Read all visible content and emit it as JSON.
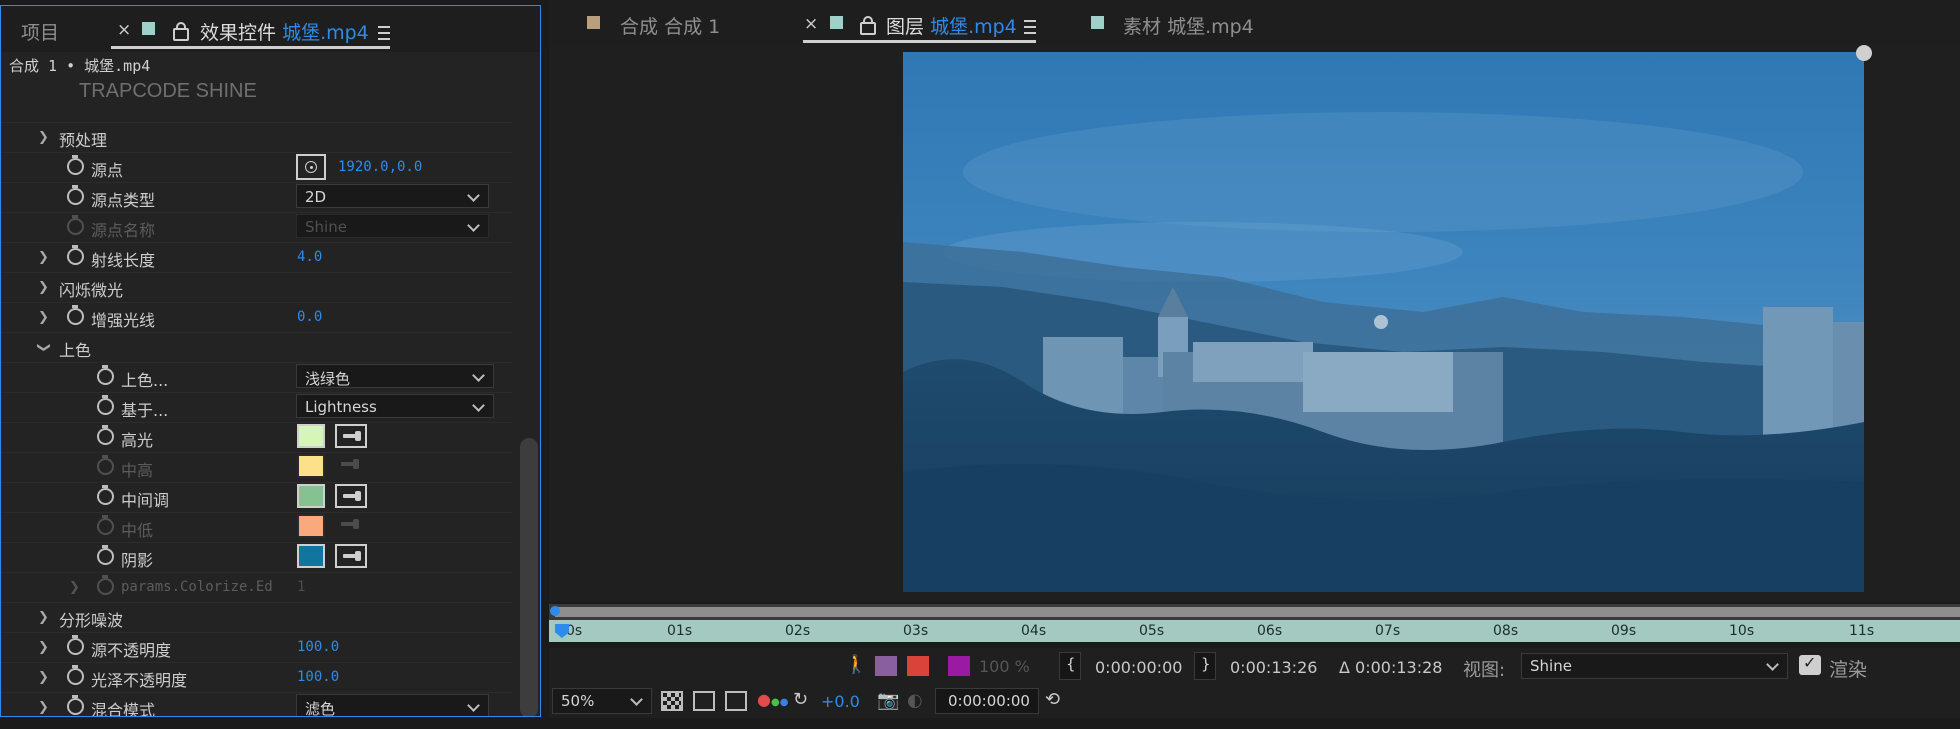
{
  "left_panel": {
    "tab_project": "项目",
    "tab_effects_prefix": "效果控件",
    "tab_effects_file": "城堡.mp4",
    "breadcrumb": "合成 1 • 城堡.mp4",
    "plugin_logo": "TRAPCODE SHINE",
    "rows": {
      "preprocess": "预处理",
      "source_point": {
        "label": "源点",
        "value": "1920.0,0.0"
      },
      "source_type": {
        "label": "源点类型",
        "value": "2D"
      },
      "source_name": {
        "label": "源点名称",
        "value": "Shine"
      },
      "ray_length": {
        "label": "射线长度",
        "value": "4.0"
      },
      "shimmer": "闪烁微光",
      "boost_light": {
        "label": "增强光线",
        "value": "0.0"
      },
      "colorize": "上色",
      "colorize_mode": {
        "label": "上色...",
        "value": "浅绿色"
      },
      "base_on": {
        "label": "基于...",
        "value": "Lightness"
      },
      "highlights": {
        "label": "高光",
        "color": "#d6f5b8"
      },
      "mid_high": {
        "label": "中高",
        "color": "#fde08a"
      },
      "midtones": {
        "label": "中间调",
        "color": "#86c291"
      },
      "mid_low": {
        "label": "中低",
        "color": "#f9a97d"
      },
      "shadows": {
        "label": "阴影",
        "color": "#12759f"
      },
      "params_ed": {
        "label": "params.Colorize.Ed",
        "value": "1"
      },
      "fractal_noise": "分形噪波",
      "source_opacity": {
        "label": "源不透明度",
        "value": "100.0"
      },
      "shine_opacity": {
        "label": "光泽不透明度",
        "value": "100.0"
      },
      "blend_mode": {
        "label": "混合模式",
        "value": "滤色"
      }
    }
  },
  "right_panel": {
    "tab_comp_prefix": "合成",
    "tab_comp_name": "合成 1",
    "tab_layer_prefix": "图层",
    "tab_layer_file": "城堡.mp4",
    "tab_footage_prefix": "素材",
    "tab_footage_file": "城堡.mp4"
  },
  "timeline": {
    "ticks": [
      "0s",
      "01s",
      "02s",
      "03s",
      "04s",
      "05s",
      "06s",
      "07s",
      "08s",
      "09s",
      "10s",
      "11s"
    ]
  },
  "controls": {
    "percent": "100 %",
    "in_time": "0:00:00:00",
    "out_time": "0:00:13:26",
    "duration": "Δ 0:00:13:28",
    "view_label": "视图:",
    "view_value": "Shine",
    "render_label": "渲染",
    "zoom": "50%",
    "exposure": "+0.0",
    "current_time": "0:00:00:00"
  },
  "colors": {
    "accent": "#2d8ceb",
    "timeline_fill": "#a4c9c0",
    "tab_square_footage": "#9fd0c9",
    "tab_square_comp": "#b99f7c"
  }
}
